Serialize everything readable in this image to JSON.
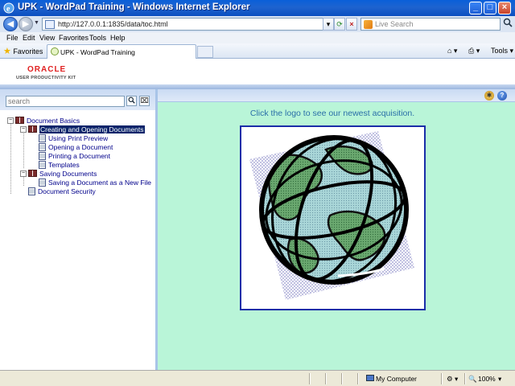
{
  "window": {
    "title": "UPK - WordPad Training - Windows Internet Explorer"
  },
  "address_bar": {
    "url": "http://127.0.0.1:1835/data/toc.html",
    "search_placeholder": "Live Search"
  },
  "menu": [
    "File",
    "Edit",
    "View",
    "Favorites",
    "Tools",
    "Help"
  ],
  "favorites_bar": {
    "favorites_label": "Favorites",
    "tab_label": "UPK - WordPad Training",
    "tools_label": "Tools"
  },
  "oracle_header": {
    "logo_text": "ORACLE",
    "logo_subtext": "USER PRODUCTIVITY KIT"
  },
  "toc": {
    "search_placeholder": "search",
    "items": [
      {
        "label": "Document Basics",
        "type": "book",
        "level": 0,
        "expanded": true
      },
      {
        "label": "Creating and Opening Documents",
        "type": "book",
        "level": 1,
        "expanded": true,
        "selected": true
      },
      {
        "label": "Using Print Preview",
        "type": "topic",
        "level": 2
      },
      {
        "label": "Opening a Document",
        "type": "topic",
        "level": 2
      },
      {
        "label": "Printing a Document",
        "type": "topic",
        "level": 2
      },
      {
        "label": "Templates",
        "type": "topic",
        "level": 2
      },
      {
        "label": "Saving Documents",
        "type": "book",
        "level": 1,
        "expanded": true
      },
      {
        "label": "Saving a Document as a New File",
        "type": "topic",
        "level": 2
      },
      {
        "label": "Document Security",
        "type": "topic",
        "level": 1
      }
    ]
  },
  "content": {
    "caption": "Click the logo to see our newest acquisition."
  },
  "status_bar": {
    "zone": "My Computer",
    "zoom": "100%"
  },
  "colors": {
    "content_background": "#b9f5d8",
    "caption_text": "#2a6fa8",
    "selected_highlight": "#0a246a",
    "oracle_red": "#e02020"
  }
}
